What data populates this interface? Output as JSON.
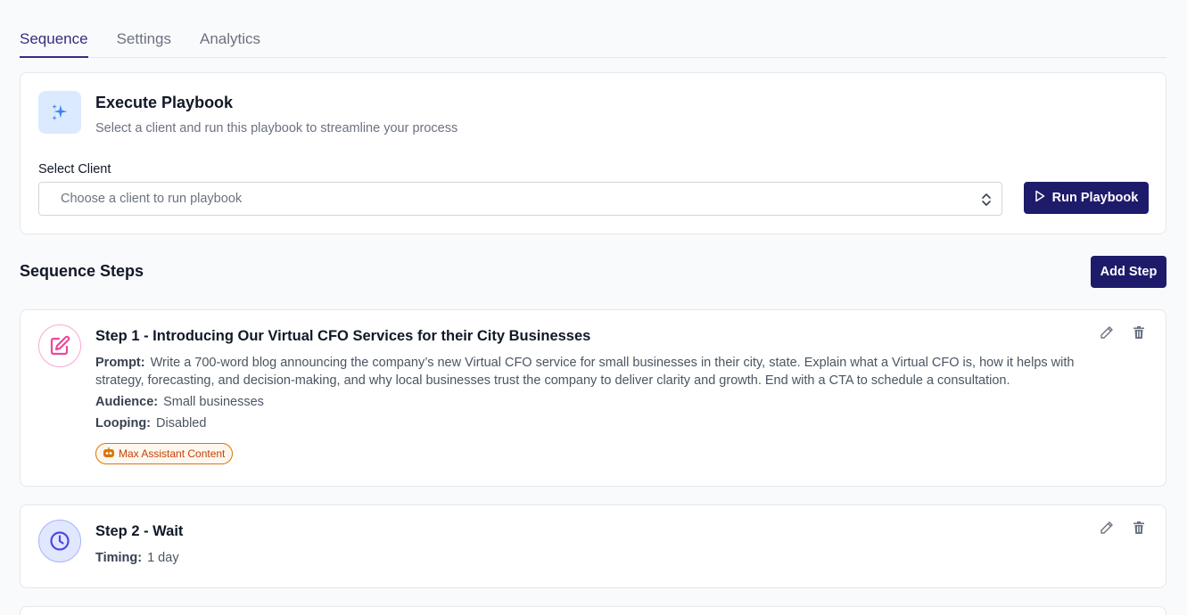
{
  "tabs": [
    {
      "label": "Sequence",
      "active": true
    },
    {
      "label": "Settings",
      "active": false
    },
    {
      "label": "Analytics",
      "active": false
    }
  ],
  "execute": {
    "icon": "sparkles-icon",
    "title": "Execute Playbook",
    "subtitle": "Select a client and run this playbook to streamline your process",
    "select_label": "Select Client",
    "select_placeholder": "Choose a client to run playbook",
    "run_button": "Run Playbook"
  },
  "sequence": {
    "title": "Sequence Steps",
    "add_button": "Add Step",
    "steps": [
      {
        "title": "Step 1 - Introducing Our Virtual CFO Services for their City Businesses",
        "icon": "edit-icon",
        "prompt_label": "Prompt:",
        "prompt": "Write a 700-word blog announcing the company’s new Virtual CFO service for small businesses in their city, state. Explain what a Virtual CFO is, how it helps with strategy, forecasting, and decision-making, and why local businesses trust the company to deliver clarity and growth. End with a CTA to schedule a consultation.",
        "audience_label": "Audience:",
        "audience": "Small businesses",
        "looping_label": "Looping:",
        "looping": "Disabled",
        "badge": "Max Assistant Content"
      },
      {
        "title": "Step 2 - Wait",
        "icon": "clock-icon",
        "timing_label": "Timing:",
        "timing": "1 day"
      }
    ]
  },
  "colors": {
    "primary": "#1e1b6b",
    "tab_active": "#312e81",
    "badge": "#d97706"
  }
}
